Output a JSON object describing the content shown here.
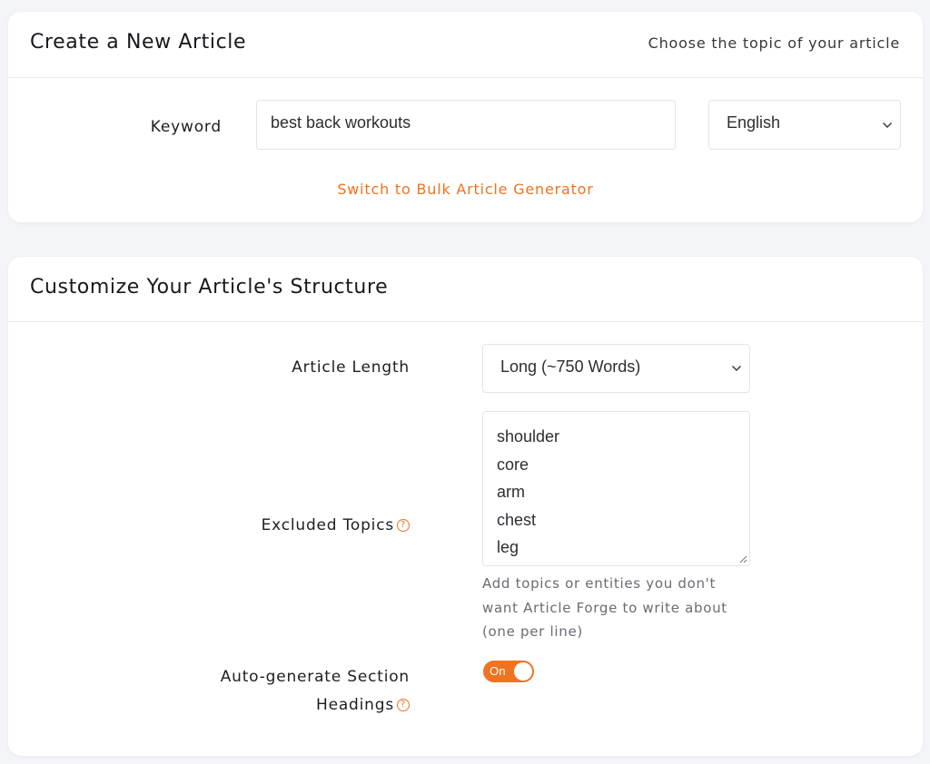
{
  "create_card": {
    "title": "Create a New Article",
    "subtitle": "Choose the topic of your article",
    "keyword_label": "Keyword",
    "keyword_value": "best back workouts",
    "language_value": "English",
    "bulk_link": "Switch to Bulk Article Generator"
  },
  "structure_card": {
    "title": "Customize Your Article's Structure",
    "length_label": "Article Length",
    "length_value": "Long (~750 Words)",
    "excluded_label": "Excluded Topics",
    "excluded_topics": [
      "shoulder",
      "core",
      "arm",
      "chest",
      "leg"
    ],
    "excluded_hint": "Add topics or entities you don't want Article Forge to write about (one per line)",
    "headings_label_line1": "Auto-generate Section",
    "headings_label_line2": "Headings",
    "headings_toggle_text": "On",
    "headings_enabled": true
  },
  "icons": {
    "help": "question-circle-icon",
    "select_chevron": "chevron-down-icon",
    "resize": "resize-grip-icon"
  },
  "colors": {
    "accent": "#f0731f",
    "background": "#f4f5f9",
    "card": "#ffffff"
  }
}
